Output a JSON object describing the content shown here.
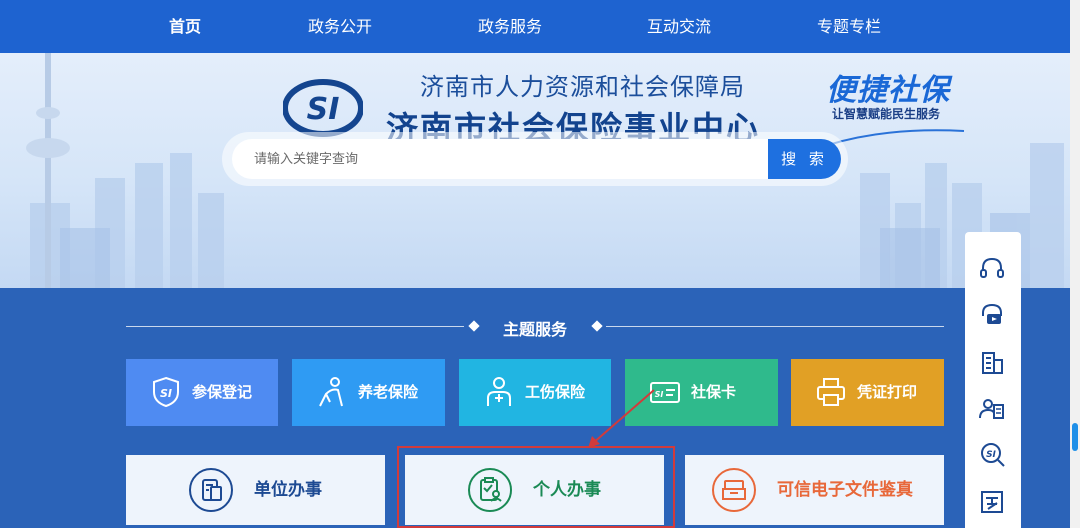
{
  "nav": {
    "items": [
      {
        "label": "首页",
        "active": true
      },
      {
        "label": "政务公开",
        "active": false
      },
      {
        "label": "政务服务",
        "active": false
      },
      {
        "label": "互动交流",
        "active": false
      },
      {
        "label": "专题专栏",
        "active": false
      }
    ]
  },
  "header": {
    "logo": "SI",
    "agency": "济南市人力资源和社会保障局",
    "center": "济南市社会保险事业中心",
    "brand": "便捷社保",
    "brand_slogan": "让智慧赋能民生服务"
  },
  "search": {
    "placeholder": "请输入关键字查询",
    "button_label": "搜 索"
  },
  "main": {
    "section_title": "主题服务",
    "tiles": [
      {
        "label": "参保登记",
        "icon": "si-shield-icon",
        "color": "#4f8bf2"
      },
      {
        "label": "养老保险",
        "icon": "elderly-person-icon",
        "color": "#2f9bf3"
      },
      {
        "label": "工伤保险",
        "icon": "injury-person-icon",
        "color": "#21b5e2"
      },
      {
        "label": "社保卡",
        "icon": "social-security-card-icon",
        "color": "#2fba8c"
      },
      {
        "label": "凭证打印",
        "icon": "printer-icon",
        "color": "#e1a025"
      }
    ],
    "cards": [
      {
        "label": "单位办事",
        "icon": "organization-document-icon",
        "color": "#1d4a93"
      },
      {
        "label": "个人办事",
        "icon": "personal-clipboard-icon",
        "color": "#1a8a55"
      },
      {
        "label": "可信电子文件鉴真",
        "icon": "file-tray-icon",
        "color": "#e8683a"
      }
    ]
  },
  "floatbar": {
    "icons": [
      "headset-icon",
      "video-consult-icon",
      "building-icon",
      "person-search-icon",
      "si-search-icon",
      "form-icon"
    ]
  },
  "colors": {
    "nav_bg": "#1e63d0",
    "main_bg": "#2b63b8",
    "highlight": "#d23b3b"
  }
}
